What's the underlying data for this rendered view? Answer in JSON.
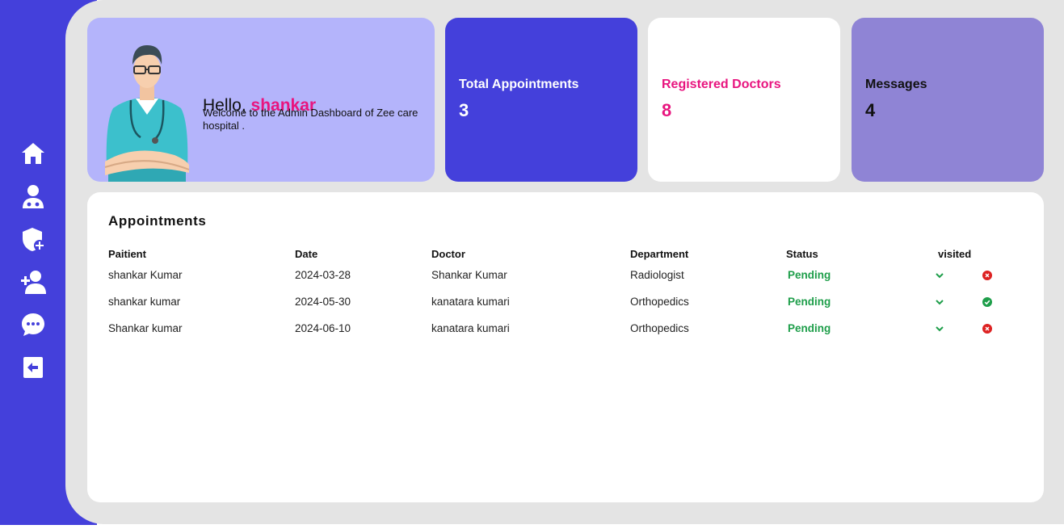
{
  "nav": {
    "items": [
      {
        "icon": "home-icon"
      },
      {
        "icon": "doctor-icon"
      },
      {
        "icon": "shield-plus-icon"
      },
      {
        "icon": "add-user-icon"
      },
      {
        "icon": "message-icon"
      },
      {
        "icon": "logout-icon"
      }
    ]
  },
  "hello": {
    "greeting": "Hello, ",
    "name": "shankar",
    "welcome": "Welcome to the Admin Dashboard of Zee care hospital ."
  },
  "stats": [
    {
      "label": "Total Appointments",
      "value": "3"
    },
    {
      "label": "Registered Doctors",
      "value": "8"
    },
    {
      "label": "Messages",
      "value": "4"
    }
  ],
  "appointments": {
    "title": "Appointments",
    "headers": [
      "Paitient",
      "Date",
      "Doctor",
      "Department",
      "Status",
      "visited"
    ],
    "rows": [
      {
        "patient": "shankar Kumar",
        "date": "2024-03-28",
        "doctor": "Shankar Kumar",
        "department": "Radiologist",
        "status": "Pending",
        "visited": false
      },
      {
        "patient": "shankar kumar",
        "date": "2024-05-30",
        "doctor": "kanatara kumari",
        "department": "Orthopedics",
        "status": "Pending",
        "visited": true
      },
      {
        "patient": "Shankar kumar",
        "date": "2024-06-10",
        "doctor": "kanatara kumari",
        "department": "Orthopedics",
        "status": "Pending",
        "visited": false
      }
    ]
  },
  "colors": {
    "sidebar": "#4440db",
    "accent_pink": "#e8157f",
    "status_green": "#1e9e4a",
    "visited_no": "#dd2222",
    "visited_yes": "#1e9e4a"
  }
}
